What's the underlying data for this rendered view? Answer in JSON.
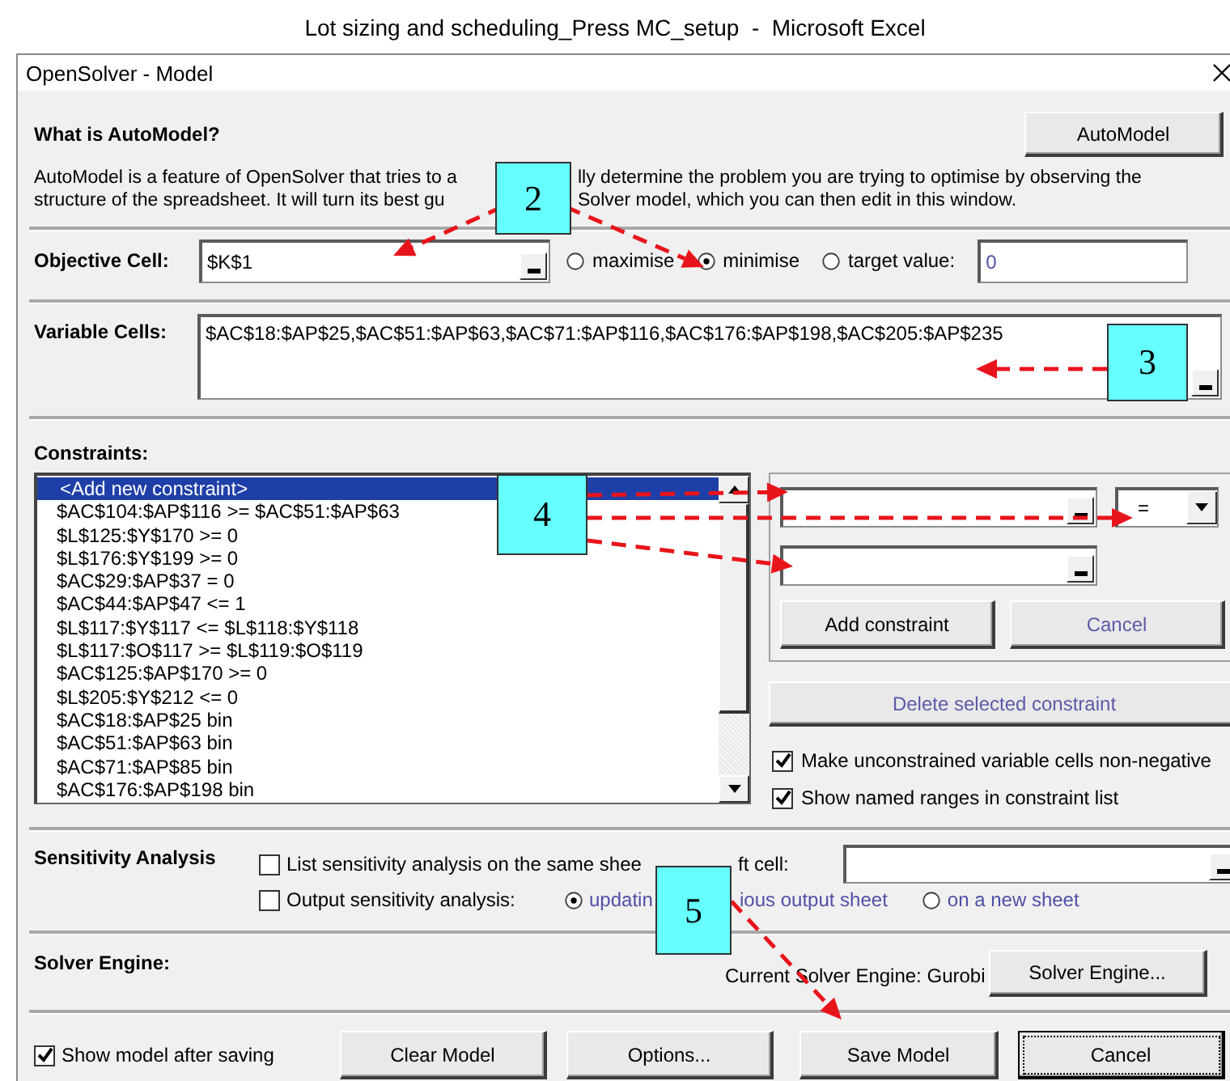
{
  "app_title": "Lot sizing and scheduling_Press MC_setup  -  Microsoft Excel",
  "dialog": {
    "title": "OpenSolver - Model"
  },
  "automodel": {
    "heading": "What is AutoModel?",
    "button": "AutoModel",
    "description_lines": [
      {
        "before": "AutoModel is a feature of OpenSolver that tries to a",
        "after": "lly determine the problem you are trying to optimise by observing the"
      },
      {
        "before": "structure of the spreadsheet. It will turn its best gu",
        "after": "Solver model, which you can then edit in this window."
      }
    ]
  },
  "objective": {
    "label": "Objective Cell:",
    "value": "$K$1",
    "options": [
      {
        "label": "maximise",
        "selected": false
      },
      {
        "label": "minimise",
        "selected": true
      },
      {
        "label": "target value:",
        "selected": false
      }
    ],
    "target_value": "0"
  },
  "variable_cells": {
    "label": "Variable Cells:",
    "value": "$AC$18:$AP$25,$AC$51:$AP$63,$AC$71:$AP$116,$AC$176:$AP$198,$AC$205:$AP$235"
  },
  "constraints": {
    "label": "Constraints:",
    "items": [
      {
        "text": "<Add new constraint>",
        "selected": true
      },
      {
        "text": "$AC$104:$AP$116 >= $AC$51:$AP$63",
        "selected": false
      },
      {
        "text": "$L$125:$Y$170 >= 0",
        "selected": false
      },
      {
        "text": "$L$176:$Y$199 >= 0",
        "selected": false
      },
      {
        "text": "$AC$29:$AP$37 = 0",
        "selected": false
      },
      {
        "text": "$AC$44:$AP$47 <= 1",
        "selected": false
      },
      {
        "text": "$L$117:$Y$117 <= $L$118:$Y$118",
        "selected": false
      },
      {
        "text": "$L$117:$O$117 >= $L$119:$O$119",
        "selected": false
      },
      {
        "text": "$AC$125:$AP$170 >= 0",
        "selected": false
      },
      {
        "text": "$L$205:$Y$212 <= 0",
        "selected": false
      },
      {
        "text": "$AC$18:$AP$25 bin",
        "selected": false
      },
      {
        "text": "$AC$51:$AP$63 bin",
        "selected": false
      },
      {
        "text": "$AC$71:$AP$85 bin",
        "selected": false
      },
      {
        "text": "$AC$176:$AP$198 bin",
        "selected": false
      }
    ],
    "relation": "=",
    "buttons": [
      {
        "label": "Add constraint",
        "disabled": false
      },
      {
        "label": "Cancel",
        "disabled": true
      }
    ],
    "delete_button": {
      "label": "Delete selected constraint",
      "disabled": true
    },
    "options": [
      {
        "label": "Make unconstrained variable cells non-negative",
        "checked": true
      },
      {
        "label": "Show named ranges in constraint list",
        "checked": true
      }
    ]
  },
  "sensitivity": {
    "label": "Sensitivity Analysis",
    "list_check": {
      "label_before": "List sensitivity analysis on the same shee",
      "label_after": "ft cell:",
      "checked": false
    },
    "output_check": {
      "label": "Output sensitivity analysis:",
      "checked": false
    },
    "destinations": [
      {
        "label_before": "updatin",
        "label_after": "ious output sheet",
        "selected": true,
        "disabled": true
      },
      {
        "label_before": "on a new sheet",
        "selected": false,
        "disabled": true
      }
    ]
  },
  "solver_engine": {
    "label": "Solver Engine:",
    "current": "Current Solver Engine: Gurobi",
    "button": "Solver Engine..."
  },
  "footer": {
    "show_model": {
      "label": "Show model after saving",
      "checked": true
    },
    "buttons": [
      {
        "label": "Clear Model",
        "focused": false
      },
      {
        "label": "Options...",
        "focused": false
      },
      {
        "label": "Save Model",
        "focused": false
      },
      {
        "label": "Cancel",
        "focused": true
      }
    ]
  },
  "callouts": [
    {
      "label": "2"
    },
    {
      "label": "3"
    },
    {
      "label": "4"
    },
    {
      "label": "5"
    }
  ]
}
